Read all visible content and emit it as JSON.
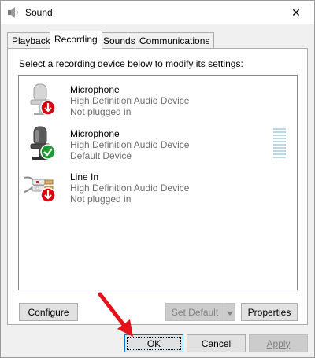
{
  "window": {
    "title": "Sound",
    "close_label": "✕"
  },
  "tabs": [
    {
      "label": "Playback",
      "active": false
    },
    {
      "label": "Recording",
      "active": true
    },
    {
      "label": "Sounds",
      "active": false
    },
    {
      "label": "Communications",
      "active": false
    }
  ],
  "panel": {
    "instruction": "Select a recording device below to modify its settings:"
  },
  "devices": [
    {
      "name": "Microphone",
      "description": "High Definition Audio Device",
      "status": "Not plugged in",
      "icon": "microphone-icon",
      "badge": "not-plugged-in-badge",
      "selected": false
    },
    {
      "name": "Microphone",
      "description": "High Definition Audio Device",
      "status": "Default Device",
      "icon": "microphone-icon",
      "badge": "default-check-badge",
      "selected": false
    },
    {
      "name": "Line In",
      "description": "High Definition Audio Device",
      "status": "Not plugged in",
      "icon": "line-in-icon",
      "badge": "not-plugged-in-badge",
      "selected": false
    }
  ],
  "buttons": {
    "configure": "Configure",
    "set_default": "Set Default",
    "properties": "Properties",
    "ok": "OK",
    "cancel": "Cancel",
    "apply": "Apply"
  },
  "colors": {
    "accent": "#0078d7",
    "badge_red": "#d9000d",
    "badge_green": "#1e9c34",
    "annotation_arrow": "#e2131a"
  }
}
